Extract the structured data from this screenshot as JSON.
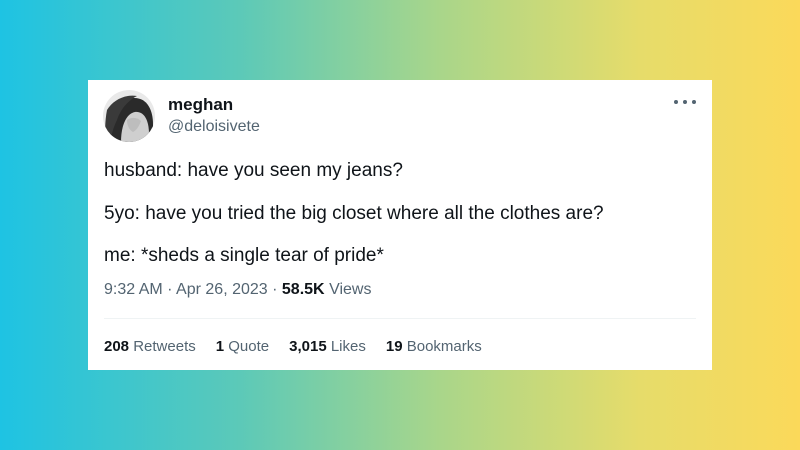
{
  "tweet": {
    "author": {
      "name": "meghan",
      "handle": "@deloisivete"
    },
    "lines": [
      "husband: have you seen my jeans?",
      "5yo: have you tried the big closet where all the clothes are?",
      "me: *sheds a single tear of pride*"
    ],
    "time": "9:32 AM",
    "separator": "·",
    "date": "Apr 26, 2023",
    "views_count": "58.5K",
    "views_label": "Views",
    "stats": [
      {
        "count": "208",
        "label": "Retweets"
      },
      {
        "count": "1",
        "label": "Quote"
      },
      {
        "count": "3,015",
        "label": "Likes"
      },
      {
        "count": "19",
        "label": "Bookmarks"
      }
    ]
  },
  "icons": {
    "more": "more-horizontal-icon",
    "avatar": "profile-avatar"
  },
  "colors": {
    "gradient_left": "#1ec3e3",
    "gradient_right": "#fbd95a",
    "text_primary": "#0f1419",
    "text_secondary": "#536471",
    "divider": "#eff3f4"
  }
}
